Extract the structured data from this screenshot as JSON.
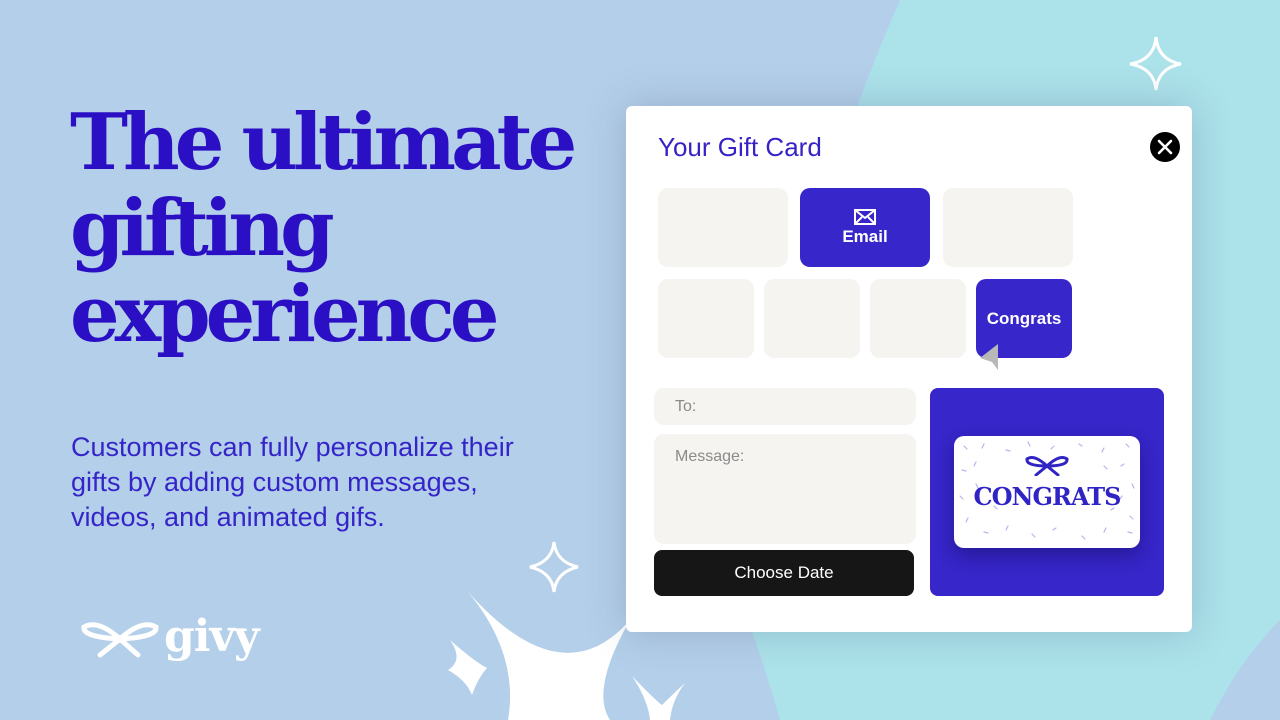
{
  "colors": {
    "background_blue": "#b4cfe9",
    "background_teal": "#ace2ea",
    "brand_purple": "#3726c9",
    "headline_purple": "#2b0fc4",
    "tile_gray": "#f5f4f0",
    "button_dark": "#161616"
  },
  "hero": {
    "headline_lines": [
      "The ultimate",
      "gifting",
      "experience"
    ],
    "subtext": "Customers can fully personalize their gifts by adding custom messages, videos, and animated gifs."
  },
  "logo": {
    "icon": "bow-icon",
    "text": "givy"
  },
  "modal": {
    "title": "Your Gift Card",
    "close_icon": "close-icon",
    "delivery_options": [
      {
        "label": "",
        "active": false
      },
      {
        "label": "Email",
        "icon": "envelope-icon",
        "active": true
      },
      {
        "label": "",
        "active": false
      }
    ],
    "design_options": [
      {
        "label": "",
        "active": false
      },
      {
        "label": "",
        "active": false
      },
      {
        "label": "",
        "active": false
      },
      {
        "label": "Congrats",
        "active": true
      }
    ],
    "to_field": {
      "placeholder": "To:"
    },
    "message_field": {
      "placeholder": "Message:"
    },
    "choose_date_label": "Choose Date",
    "preview": {
      "card_text": "CONGRATS",
      "card_icon": "bow-icon"
    }
  },
  "cursor": {
    "icon": "pointer-cursor-icon"
  }
}
